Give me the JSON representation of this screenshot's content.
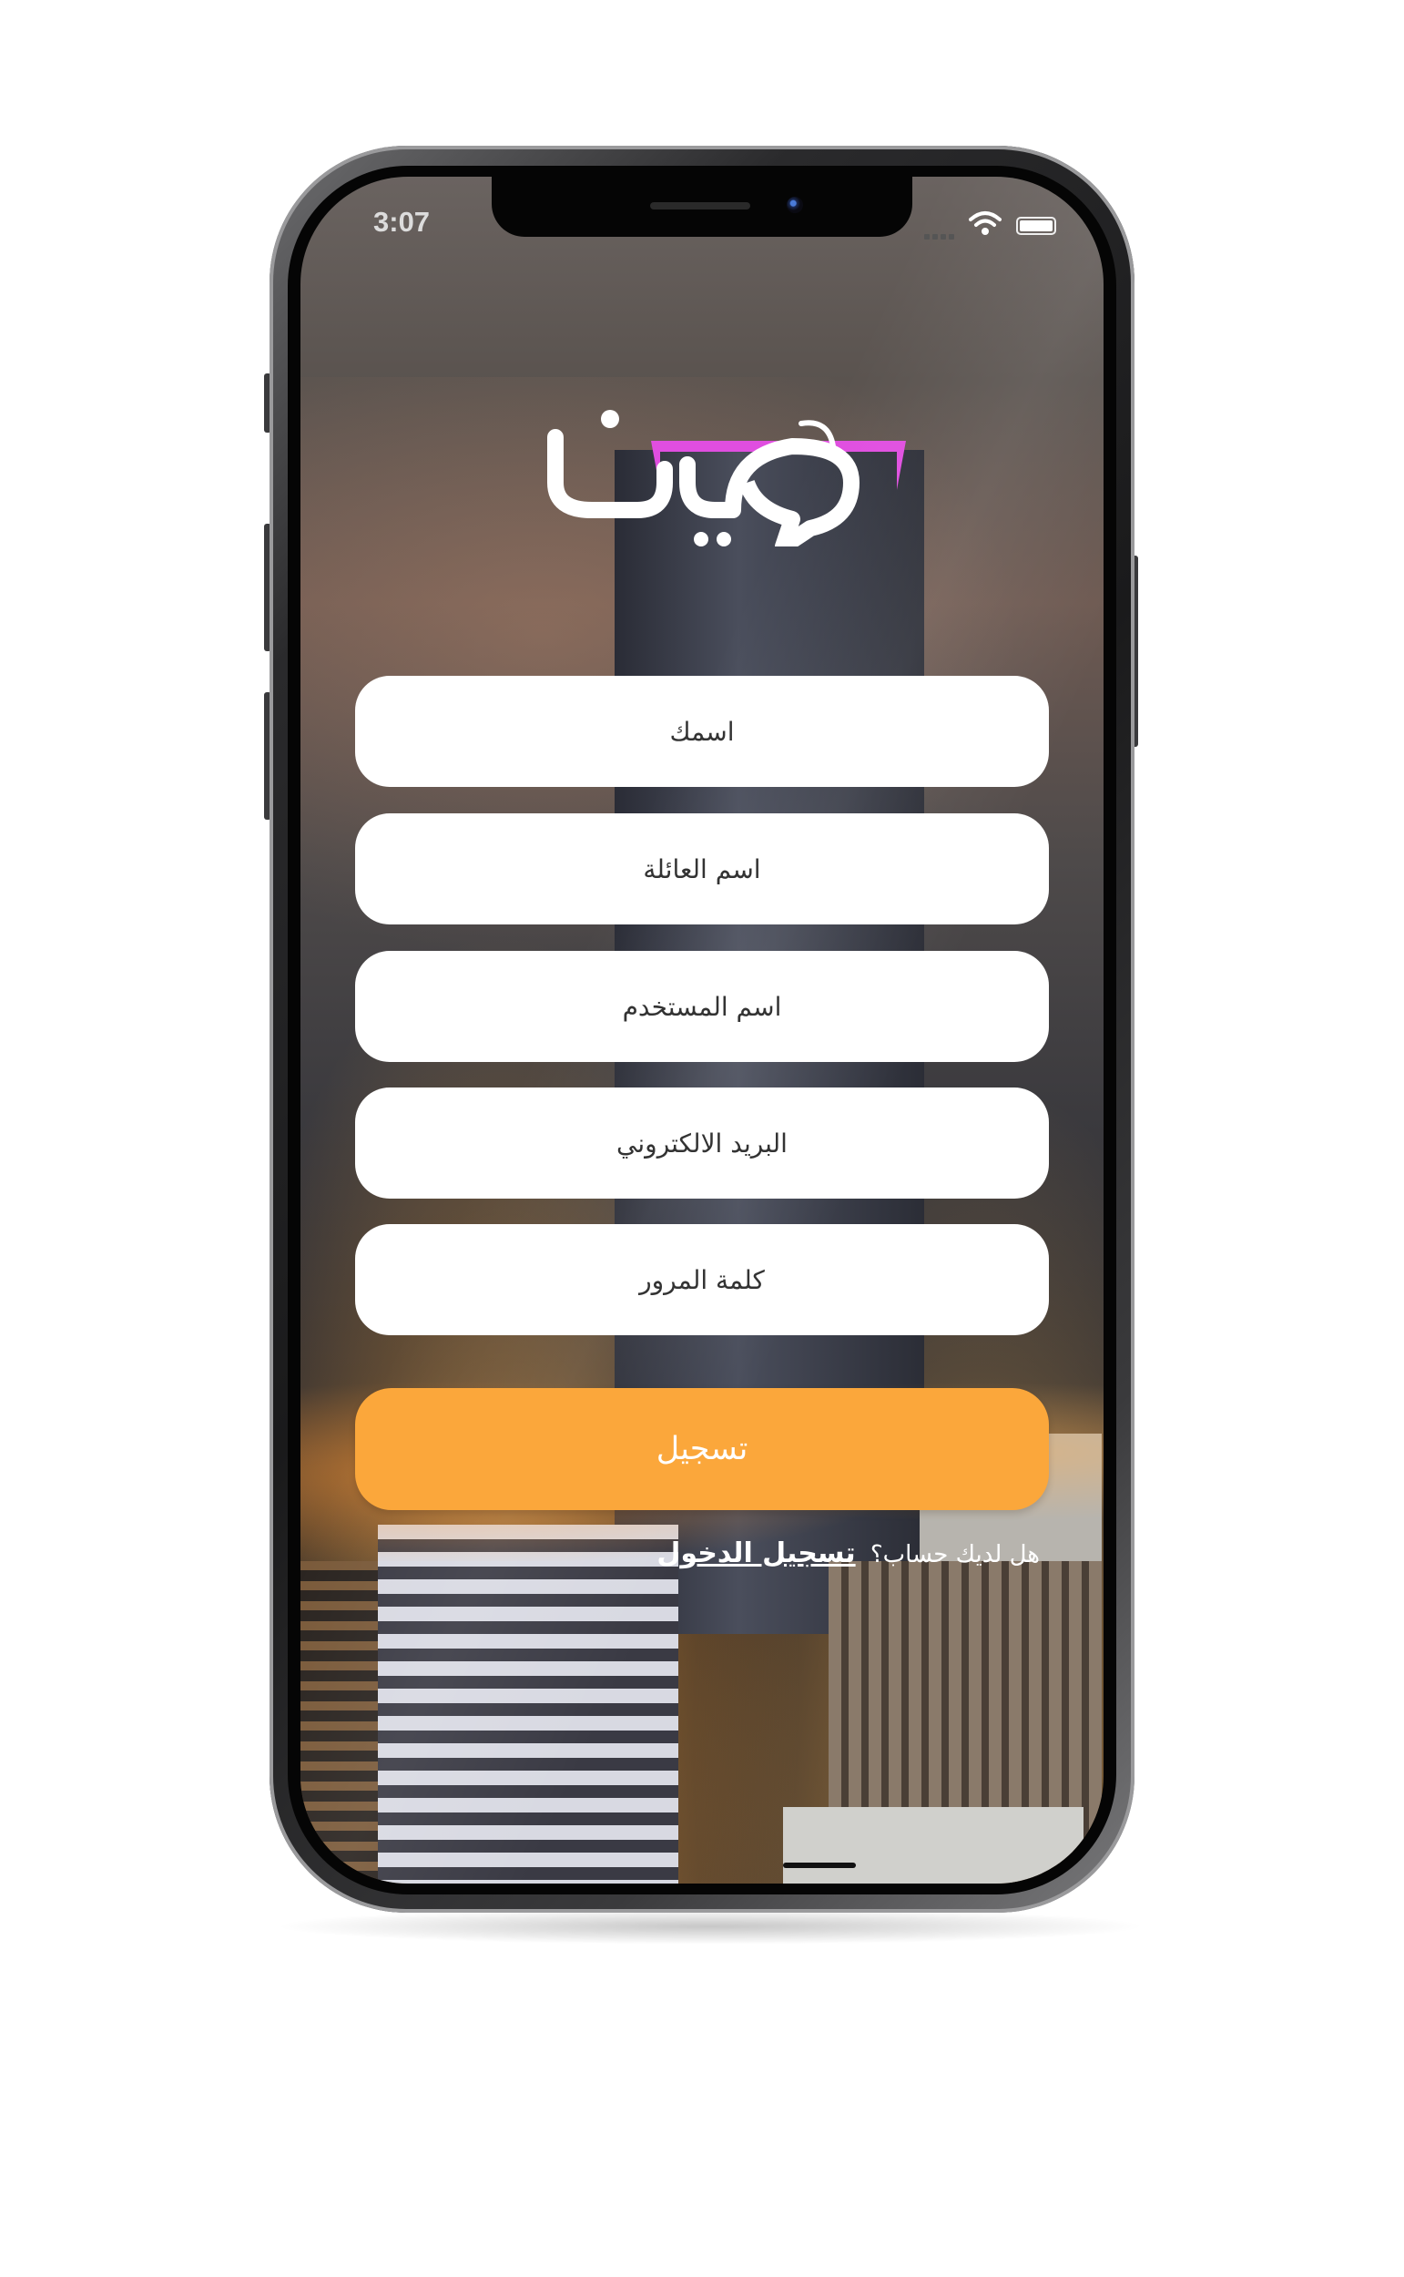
{
  "status_bar": {
    "time": "3:07",
    "wifi_icon": "wifi-icon",
    "battery_icon": "battery-icon"
  },
  "logo": {
    "icon": "app-logo-icon",
    "accent_color": "#e04ee0"
  },
  "form": {
    "first_name_placeholder": "اسمك",
    "family_name_placeholder": "اسم العائلة",
    "username_placeholder": "اسم المستخدم",
    "email_placeholder": "البريد الالكتروني",
    "password_placeholder": "كلمة المرور",
    "register_label": "تسجيل",
    "register_color": "#fba73b"
  },
  "footer": {
    "question": "هل لديك حساب؟",
    "login_link": "تسجيل الدخول"
  }
}
